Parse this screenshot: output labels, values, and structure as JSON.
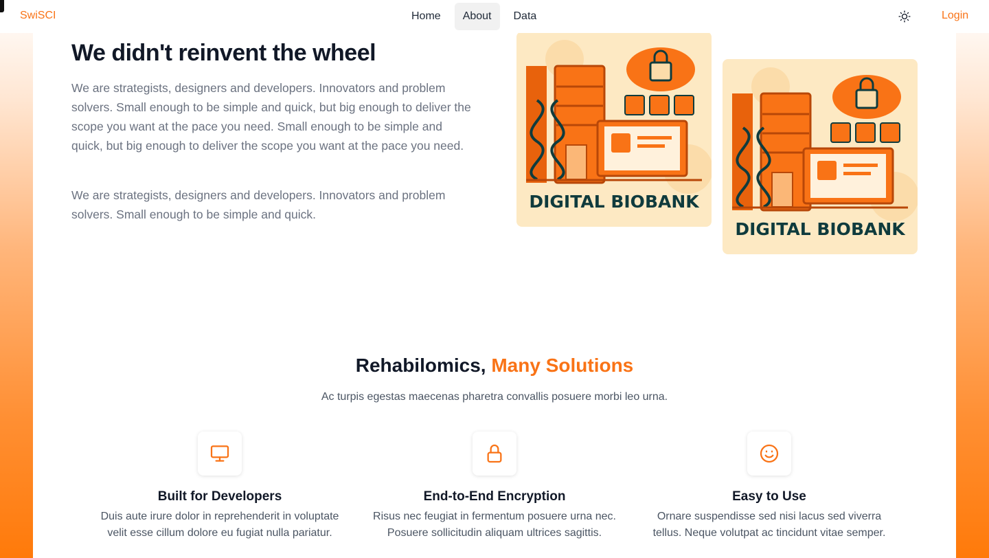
{
  "nav": {
    "brand": "SwiSCI",
    "links": [
      {
        "label": "Home"
      },
      {
        "label": "About"
      },
      {
        "label": "Data"
      }
    ],
    "login": "Login"
  },
  "hero": {
    "title": "We didn't reinvent the wheel",
    "p1": "We are strategists, designers and developers. Innovators and problem solvers. Small enough to be simple and quick, but big enough to deliver the scope you want at the pace you need. Small enough to be simple and quick, but big enough to deliver the scope you want at the pace you need.",
    "p2": "We are strategists, designers and developers. Innovators and problem solvers. Small enough to be simple and quick.",
    "image_caption": "DIGITAL BIOBANK"
  },
  "solutions": {
    "title_main": "Rehabilomics,",
    "title_accent": "Many Solutions",
    "subtitle": "Ac turpis egestas maecenas pharetra convallis posuere morbi leo urna.",
    "features": [
      {
        "icon": "monitor-icon",
        "title": "Built for Developers",
        "desc": "Duis aute irure dolor in reprehenderit in voluptate velit esse cillum dolore eu fugiat nulla pariatur."
      },
      {
        "icon": "lock-icon",
        "title": "End-to-End Encryption",
        "desc": "Risus nec feugiat in fermentum posuere urna nec. Posuere sollicitudin aliquam ultrices sagittis."
      },
      {
        "icon": "smile-icon",
        "title": "Easy to Use",
        "desc": "Ornare suspendisse sed nisi lacus sed viverra tellus. Neque volutpat ac tincidunt vitae semper."
      }
    ]
  },
  "colors": {
    "accent": "#f97316",
    "heading": "#111827",
    "body_text": "#6b7280",
    "image_bg": "#fde9c3",
    "dark_teal": "#0f3b3d"
  }
}
